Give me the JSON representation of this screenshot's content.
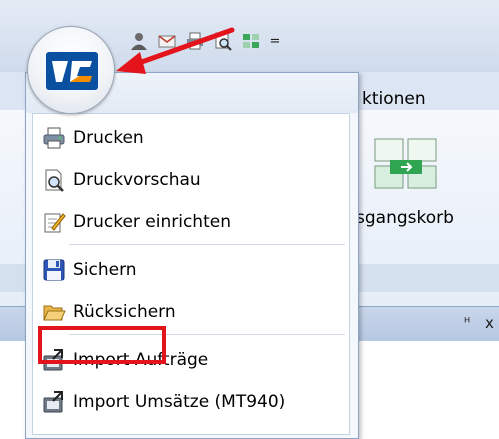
{
  "ribbon": {
    "tab_label": "ktionen",
    "eingangskorb_label": "sgangskorb"
  },
  "quick_access_toolbar": {
    "icons": [
      "user-icon",
      "mail-icon",
      "print-icon",
      "print-preview-icon",
      "transfer-icon"
    ],
    "dropdown_glyph": "="
  },
  "app_menu": {
    "items": [
      {
        "label": "Drucken",
        "icon": "printer-icon"
      },
      {
        "label": "Druckvorschau",
        "icon": "print-preview-icon"
      },
      {
        "label": "Drucker einrichten",
        "icon": "printer-setup-icon"
      },
      {
        "label": "Sichern",
        "icon": "floppy-disk-icon"
      },
      {
        "label": "Rücksichern",
        "icon": "folder-open-icon"
      },
      {
        "label": "Import Aufträge",
        "icon": "import-icon"
      },
      {
        "label": "Import Umsätze (MT940)",
        "icon": "import-icon"
      }
    ]
  },
  "panel": {
    "pin_glyph": "ᵸ",
    "close_glyph": "x"
  },
  "colors": {
    "annotation_red": "#e3141b",
    "brand_blue": "#0a50a0",
    "brand_orange": "#f28c00"
  }
}
